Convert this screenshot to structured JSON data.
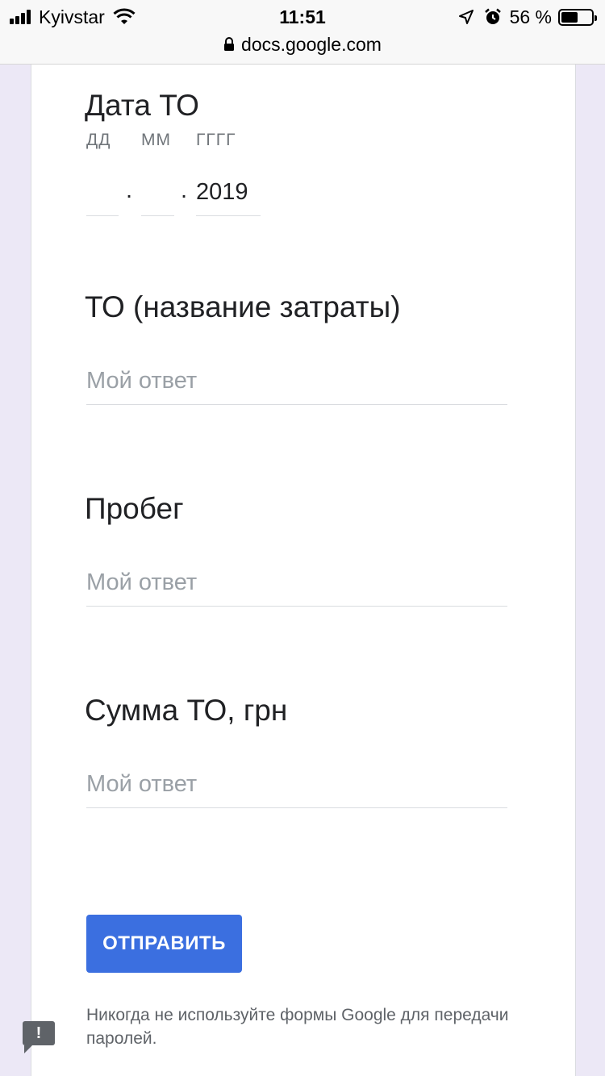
{
  "status": {
    "carrier": "Kyivstar",
    "time": "11:51",
    "battery": "56 %",
    "battery_level": 0.56,
    "icons": [
      "signal-icon",
      "wifi-icon",
      "location-icon",
      "alarm-icon",
      "battery-icon"
    ]
  },
  "browser": {
    "url": "docs.google.com"
  },
  "form": {
    "date_question": {
      "title": "Дата ТО",
      "day_label": "ДД",
      "month_label": "ММ",
      "year_label": "ГГГГ",
      "day_value": "",
      "month_value": "",
      "year_value": "2019",
      "separator": "."
    },
    "questions": [
      {
        "title": "ТО (название затраты)",
        "placeholder": "Мой ответ"
      },
      {
        "title": "Пробег",
        "placeholder": "Мой ответ"
      },
      {
        "title": "Сумма ТО, грн",
        "placeholder": "Мой ответ"
      }
    ],
    "submit_label": "ОТПРАВИТЬ",
    "footer_note": "Никогда не используйте формы Google для передачи паролей.",
    "report_label": "!"
  },
  "colors": {
    "accent": "#3b6fe0",
    "background": "#ece8f6"
  }
}
